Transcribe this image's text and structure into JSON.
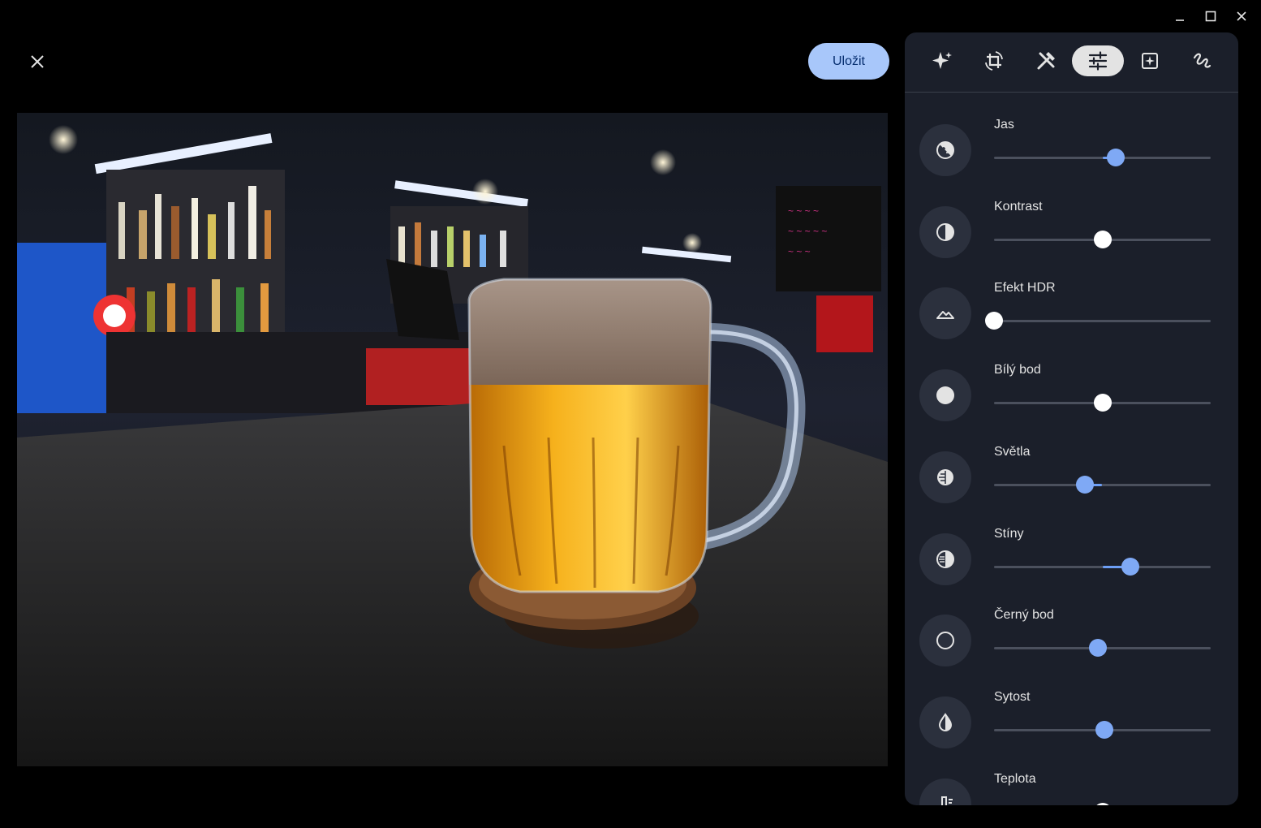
{
  "window": {
    "minimize_icon": "minimize-icon",
    "maximize_icon": "maximize-icon",
    "close_icon": "close-icon"
  },
  "editor": {
    "close_icon": "close-icon",
    "save_label": "Uložit",
    "accent_color": "#a8c7fa"
  },
  "toolbar": {
    "tools": [
      {
        "icon": "auto-enhance-sparkle-icon",
        "active": false
      },
      {
        "icon": "crop-rotate-icon",
        "active": false
      },
      {
        "icon": "tools-icon",
        "active": false
      },
      {
        "icon": "adjust-sliders-icon",
        "active": true
      },
      {
        "icon": "filters-icon",
        "active": false
      },
      {
        "icon": "markup-icon",
        "active": false
      }
    ]
  },
  "adjustments": [
    {
      "label": "Jas",
      "icon": "brightness-icon",
      "value": 0.56
    },
    {
      "label": "Kontrast",
      "icon": "contrast-icon",
      "value": 0.5
    },
    {
      "label": "Efekt HDR",
      "icon": "hdr-mountain-icon",
      "value": 0.0
    },
    {
      "label": "Bílý bod",
      "icon": "white-point-icon",
      "value": 0.5
    },
    {
      "label": "Světla",
      "icon": "highlights-icon",
      "value": 0.42
    },
    {
      "label": "Stíny",
      "icon": "shadows-icon",
      "value": 0.63
    },
    {
      "label": "Černý bod",
      "icon": "black-point-icon",
      "value": 0.48
    },
    {
      "label": "Sytost",
      "icon": "saturation-icon",
      "value": 0.51
    },
    {
      "label": "Teplota",
      "icon": "temperature-icon",
      "value": 0.5
    }
  ],
  "photo": {
    "subject": "beer-mug-photo"
  }
}
